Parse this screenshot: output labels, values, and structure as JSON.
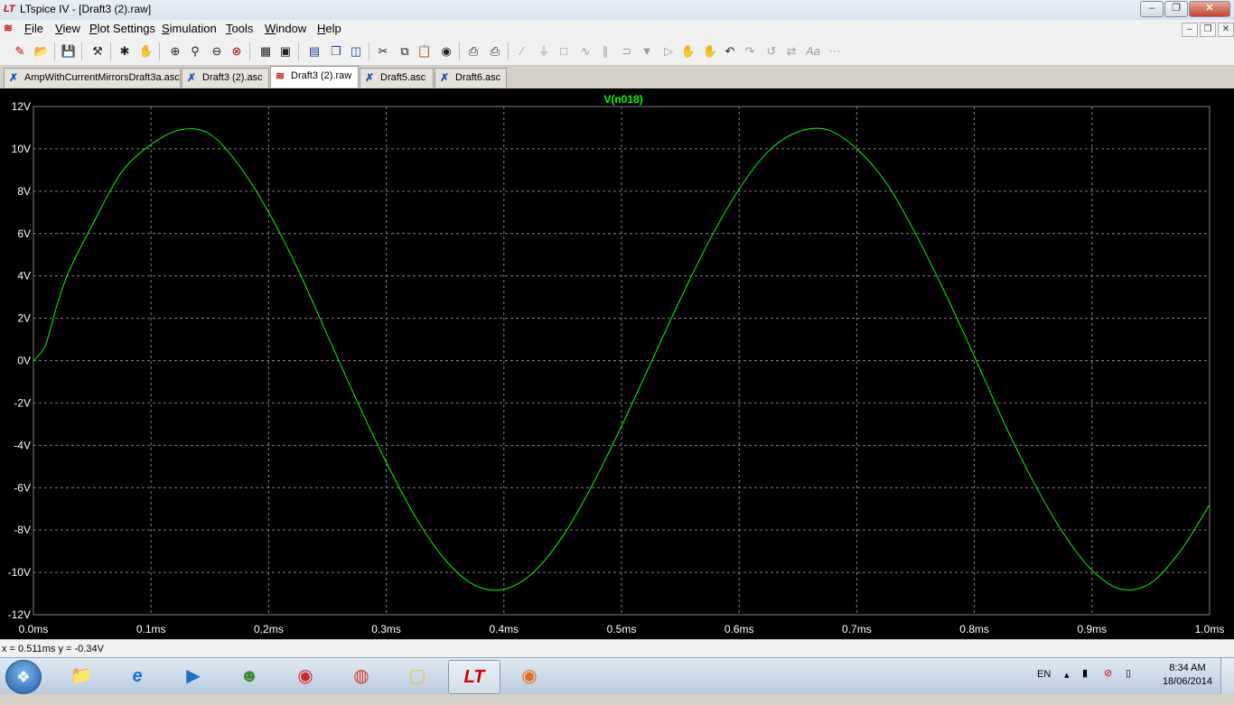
{
  "window": {
    "title": "LTspice IV - [Draft3 (2).raw]"
  },
  "menu": {
    "items": [
      {
        "label": "File",
        "first": "F",
        "rest": "ile"
      },
      {
        "label": "View",
        "first": "V",
        "rest": "iew"
      },
      {
        "label": "Plot Settings",
        "first": "P",
        "rest": "lot Settings"
      },
      {
        "label": "Simulation",
        "first": "S",
        "rest": "imulation"
      },
      {
        "label": "Tools",
        "first": "T",
        "rest": "ools"
      },
      {
        "label": "Window",
        "first": "W",
        "rest": "indow"
      },
      {
        "label": "Help",
        "first": "H",
        "rest": "elp"
      }
    ]
  },
  "tabs": [
    {
      "label": "AmpWithCurrentMirrorsDraft3a.asc",
      "icon": "schematic-icon",
      "active": false
    },
    {
      "label": "Draft3 (2).asc",
      "icon": "schematic-icon",
      "active": false
    },
    {
      "label": "Draft3 (2).raw",
      "icon": "waveform-icon",
      "active": true
    },
    {
      "label": "Draft5.asc",
      "icon": "schematic-icon",
      "active": false
    },
    {
      "label": "Draft6.asc",
      "icon": "schematic-icon",
      "active": false
    }
  ],
  "colors": {
    "trace": "#00ff00",
    "plot_bg": "#000000",
    "axis_text": "#ffffff",
    "grid": "#808080"
  },
  "chart_data": {
    "type": "line",
    "title": "V(n018)",
    "xlabel": "",
    "ylabel": "",
    "x_ticks": [
      "0.0ms",
      "0.1ms",
      "0.2ms",
      "0.3ms",
      "0.4ms",
      "0.5ms",
      "0.6ms",
      "0.7ms",
      "0.8ms",
      "0.9ms",
      "1.0ms"
    ],
    "y_ticks": [
      "12V",
      "10V",
      "8V",
      "6V",
      "4V",
      "2V",
      "0V",
      "-2V",
      "-4V",
      "-6V",
      "-8V",
      "-10V",
      "-12V"
    ],
    "xlim": [
      0,
      1.0
    ],
    "ylim": [
      -12,
      12
    ],
    "grid": true,
    "series": [
      {
        "name": "V(n018)",
        "x": [
          0.0,
          0.01,
          0.02,
          0.03,
          0.05,
          0.075,
          0.1,
          0.125,
          0.15,
          0.175,
          0.2,
          0.225,
          0.25,
          0.275,
          0.3,
          0.325,
          0.35,
          0.375,
          0.4,
          0.425,
          0.45,
          0.475,
          0.5,
          0.525,
          0.55,
          0.575,
          0.6,
          0.625,
          0.65,
          0.675,
          0.7,
          0.725,
          0.75,
          0.775,
          0.8,
          0.825,
          0.85,
          0.875,
          0.9,
          0.925,
          0.95,
          0.975,
          1.0
        ],
        "y": [
          0.0,
          0.7,
          2.6,
          4.2,
          6.4,
          8.9,
          10.2,
          10.9,
          10.7,
          9.2,
          7.0,
          4.3,
          1.2,
          -1.9,
          -4.8,
          -7.4,
          -9.4,
          -10.6,
          -10.8,
          -10.0,
          -8.3,
          -5.9,
          -3.1,
          -0.1,
          2.9,
          5.7,
          8.1,
          9.9,
          10.8,
          10.9,
          10.0,
          8.4,
          6.0,
          3.2,
          0.2,
          -2.9,
          -5.7,
          -8.1,
          -9.9,
          -10.8,
          -10.5,
          -9.0,
          -6.8
        ]
      }
    ]
  },
  "status": {
    "cursor": "x = 0.511ms   y = -0.34V"
  },
  "taskbar": {
    "language": "EN",
    "time": "8:34 AM",
    "date": "18/06/2014"
  }
}
